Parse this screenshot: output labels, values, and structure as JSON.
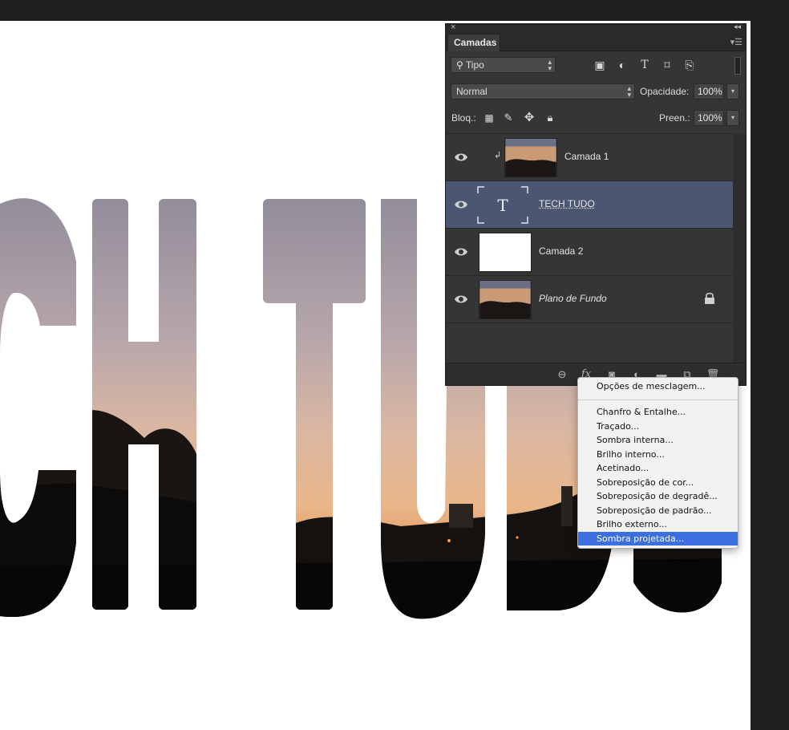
{
  "panel": {
    "title": "Camadas",
    "filter": {
      "kind": "Tipo",
      "icons": [
        "image-filter-icon",
        "adjustment-filter-icon",
        "type-filter-icon",
        "shape-filter-icon",
        "smart-object-filter-icon"
      ]
    },
    "blend_mode": "Normal",
    "opacity_label": "Opacidade:",
    "opacity_value": "100%",
    "lock_label": "Bloq.:",
    "fill_label": "Preen.:",
    "fill_value": "100%",
    "layers": [
      {
        "name": "Camada 1",
        "thumb": "photo",
        "clipped": true,
        "selected": false
      },
      {
        "name": "TECH TUDO",
        "thumb": "text",
        "thumb_glyph": "T",
        "selected": true
      },
      {
        "name": "Camada 2",
        "thumb": "white",
        "selected": false
      },
      {
        "name": "Plano de Fundo",
        "thumb": "photo",
        "locked": true,
        "selected": false
      }
    ],
    "footer_icons": [
      "link-layers-icon",
      "fx-icon",
      "add-mask-icon",
      "adjustment-layer-icon",
      "new-group-icon",
      "new-layer-icon",
      "delete-layer-icon"
    ],
    "footer_fx": "fx"
  },
  "menu": {
    "items": [
      "Opções de mesclagem...",
      "Chanfro & Entalhe...",
      "Traçado...",
      "Sombra interna...",
      "Brilho interno...",
      "Acetinado...",
      "Sobreposição de cor...",
      "Sobreposição de degradê...",
      "Sobreposição de padrão...",
      "Brilho externo...",
      "Sombra projetada..."
    ],
    "active_index": 10
  },
  "canvas": {
    "text": "TECH TUDO",
    "visible_text": "CH TUDO"
  },
  "colors": {
    "selected_layer": "#4b5672",
    "menu_highlight": "#3d6ee0",
    "panel_bg": "#353535"
  }
}
